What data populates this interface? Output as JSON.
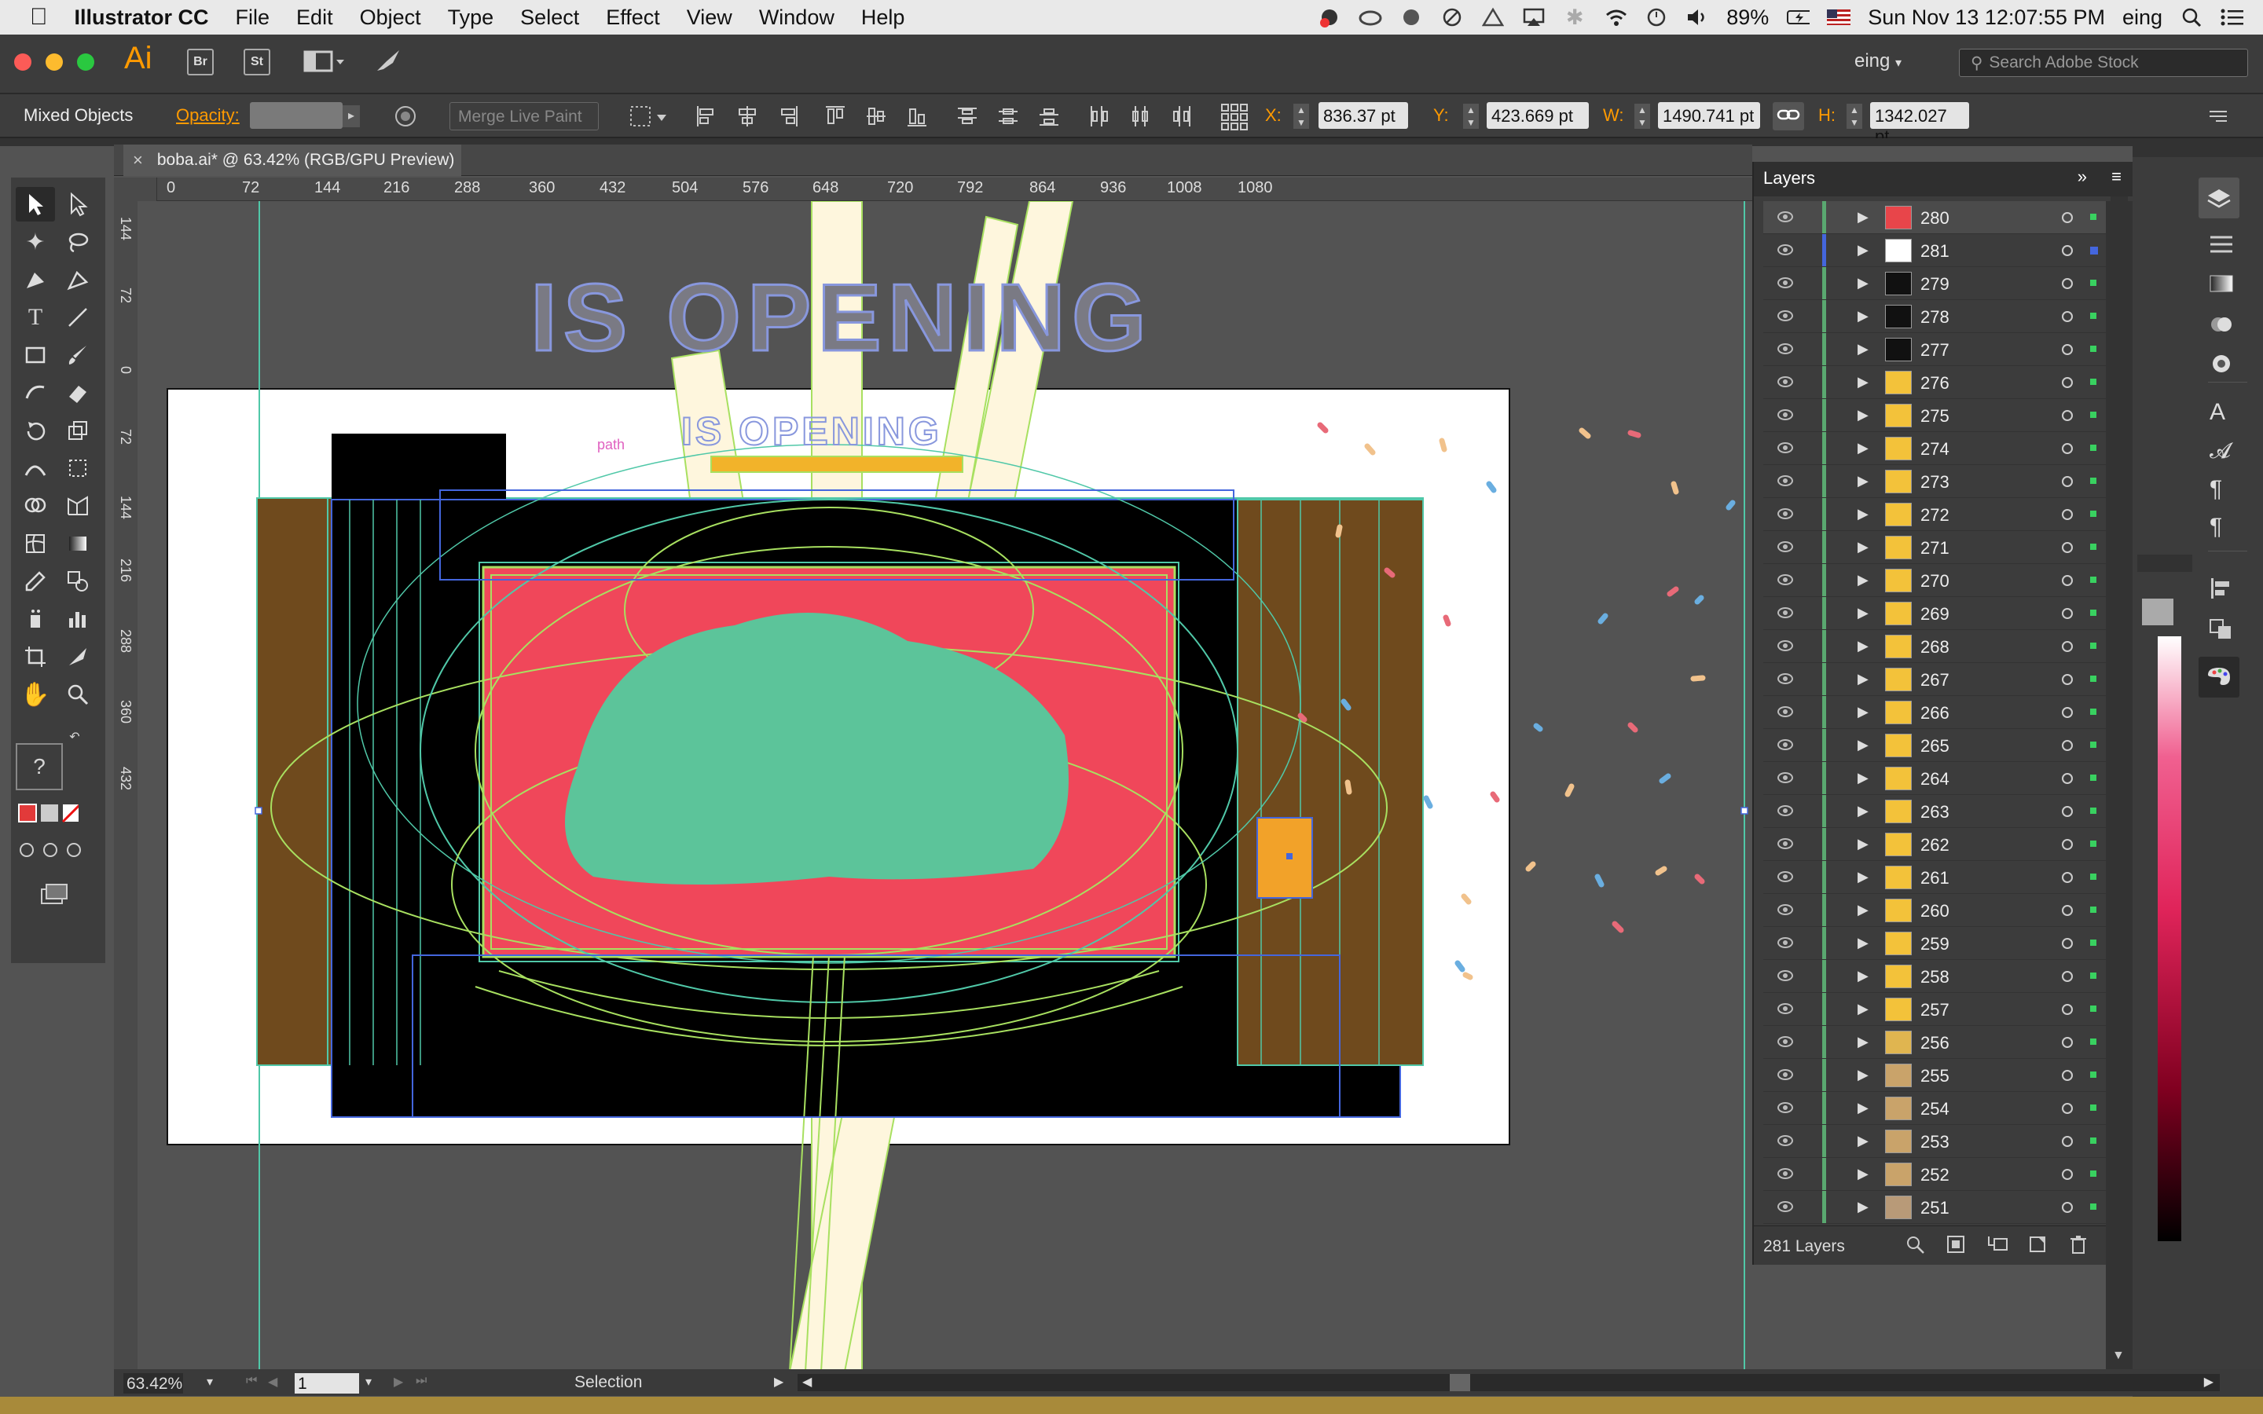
{
  "menubar": {
    "app": "Illustrator CC",
    "items": [
      "File",
      "Edit",
      "Object",
      "Type",
      "Select",
      "Effect",
      "View",
      "Window",
      "Help"
    ],
    "battery": "89%",
    "datetime": "Sun Nov 13  12:07:55 PM",
    "user": "eing"
  },
  "appbar": {
    "logo": "Ai",
    "bridge": "Br",
    "stock": "St",
    "workspace": "eing",
    "search_placeholder": "Search Adobe Stock"
  },
  "control": {
    "selection": "Mixed Objects",
    "opacity_label": "Opacity:",
    "merge_live_paint": "Merge Live Paint",
    "x_label": "X:",
    "x_value": "836.37 pt",
    "y_label": "Y:",
    "y_value": "423.669 pt",
    "w_label": "W:",
    "w_value": "1490.741 pt",
    "h_label": "H:",
    "h_value": "1342.027 pt"
  },
  "document": {
    "tab_title": "boba.ai* @ 63.42% (RGB/GPU Preview)",
    "heading_outline": "IS OPENING",
    "heading_inner": "IS OPENING",
    "path_label": "path"
  },
  "ruler": {
    "h_ticks": [
      "0",
      "72",
      "144",
      "216",
      "288",
      "360",
      "432",
      "504",
      "576",
      "648",
      "720",
      "792",
      "864",
      "936",
      "1008",
      "1080"
    ],
    "v_ticks": [
      "144",
      "72",
      "0",
      "72",
      "144",
      "216",
      "288",
      "360",
      "432"
    ]
  },
  "layers": {
    "title": "Layers",
    "rows": [
      {
        "name": "280",
        "thumb": "#e8454a"
      },
      {
        "name": "281",
        "thumb": "#ffffff"
      },
      {
        "name": "279",
        "thumb": "#111111"
      },
      {
        "name": "278",
        "thumb": "#111111"
      },
      {
        "name": "277",
        "thumb": "#111111"
      },
      {
        "name": "276",
        "thumb": "#f3c23a"
      },
      {
        "name": "275",
        "thumb": "#f3c23a"
      },
      {
        "name": "274",
        "thumb": "#f3c23a"
      },
      {
        "name": "273",
        "thumb": "#f3c23a"
      },
      {
        "name": "272",
        "thumb": "#f3c23a"
      },
      {
        "name": "271",
        "thumb": "#f3c23a"
      },
      {
        "name": "270",
        "thumb": "#f3c23a"
      },
      {
        "name": "269",
        "thumb": "#f3c23a"
      },
      {
        "name": "268",
        "thumb": "#f3c23a"
      },
      {
        "name": "267",
        "thumb": "#f3c23a"
      },
      {
        "name": "266",
        "thumb": "#f3c23a"
      },
      {
        "name": "265",
        "thumb": "#f3c23a"
      },
      {
        "name": "264",
        "thumb": "#f3c23a"
      },
      {
        "name": "263",
        "thumb": "#f3c23a"
      },
      {
        "name": "262",
        "thumb": "#f3c23a"
      },
      {
        "name": "261",
        "thumb": "#f3c23a"
      },
      {
        "name": "260",
        "thumb": "#f3c23a"
      },
      {
        "name": "259",
        "thumb": "#f3c23a"
      },
      {
        "name": "258",
        "thumb": "#f3c23a"
      },
      {
        "name": "257",
        "thumb": "#f3c23a"
      },
      {
        "name": "256",
        "thumb": "#e0b550"
      },
      {
        "name": "255",
        "thumb": "#c9a36a"
      },
      {
        "name": "254",
        "thumb": "#c9a36a"
      },
      {
        "name": "253",
        "thumb": "#c9a36a"
      },
      {
        "name": "252",
        "thumb": "#c9a36a"
      },
      {
        "name": "251",
        "thumb": "#b89a78"
      }
    ],
    "count": "281 Layers"
  },
  "status": {
    "zoom": "63.42%",
    "artboard": "1",
    "tool": "Selection"
  },
  "toolbar": {
    "help": "?"
  }
}
